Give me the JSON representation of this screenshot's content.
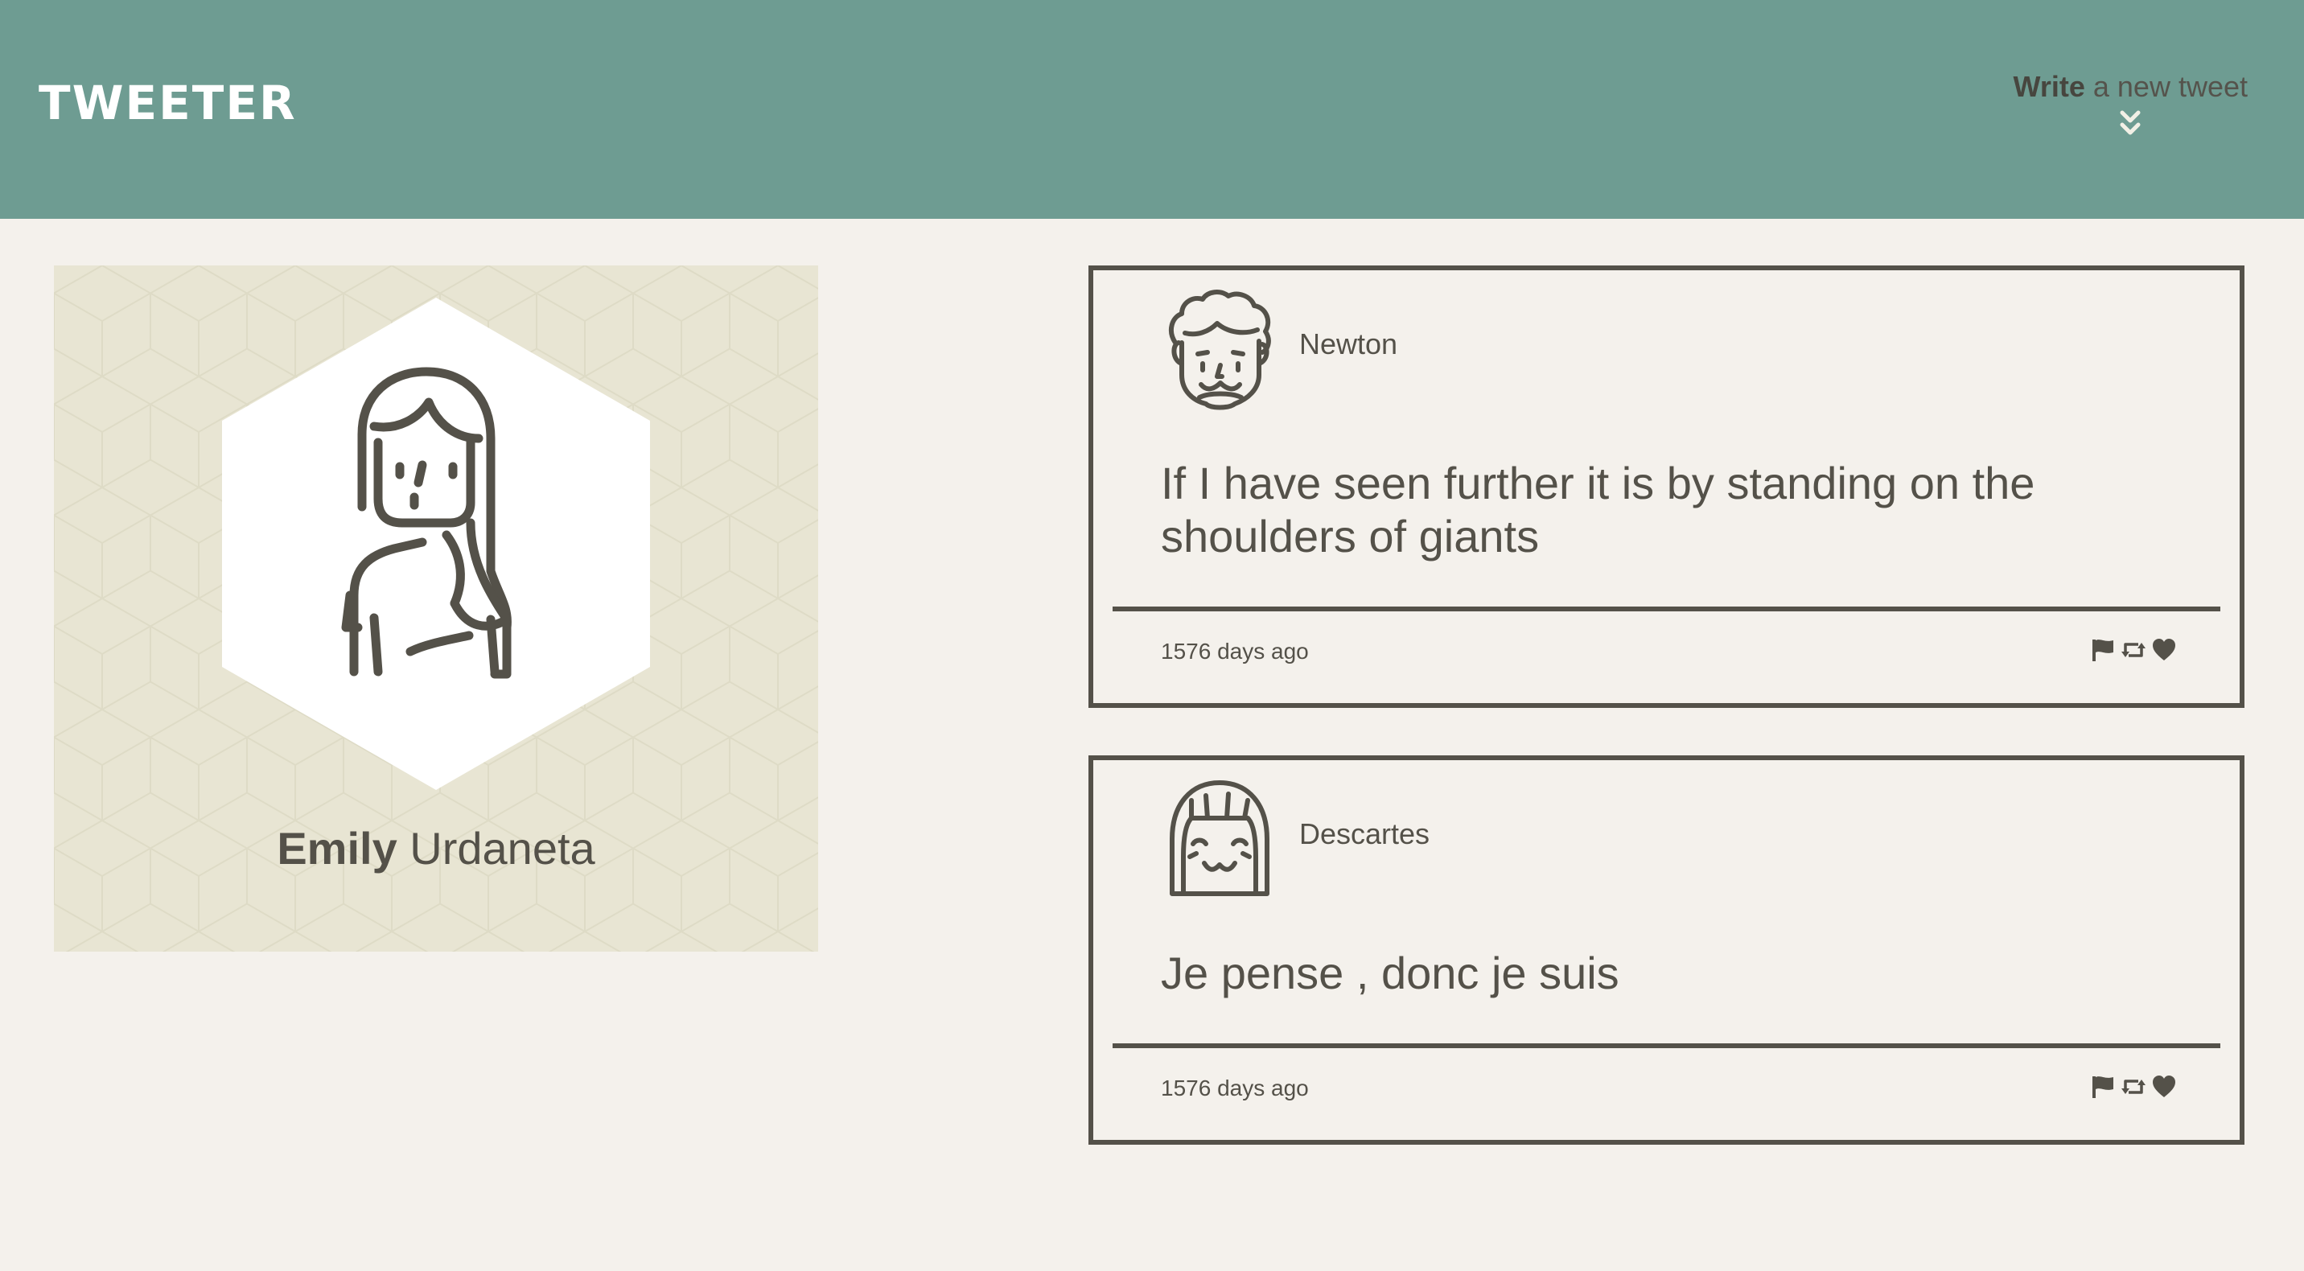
{
  "header": {
    "brand": "TWEETER",
    "compose_bold": "Write",
    "compose_rest": " a new tweet",
    "compose_icon": "double-chevron-down-icon"
  },
  "profile": {
    "first_name": "Emily",
    "last_name": " Urdaneta",
    "avatar_icon": "woman-avatar-icon"
  },
  "tweets": [
    {
      "author": "Newton",
      "avatar_icon": "curly-hair-man-avatar-icon",
      "text": "If I have seen further it is by standing on the shoulders of giants",
      "time": "1576 days ago",
      "actions": [
        "flag-icon",
        "retweet-icon",
        "heart-icon"
      ]
    },
    {
      "author": "Descartes",
      "avatar_icon": "bob-hair-avatar-icon",
      "text": "Je pense , donc je suis",
      "time": "1576 days ago",
      "actions": [
        "flag-icon",
        "retweet-icon",
        "heart-icon"
      ]
    }
  ],
  "colors": {
    "header_bg": "#6e9c92",
    "page_bg": "#f4f1ec",
    "profile_bg": "#e8e5d3",
    "ink": "#545149"
  }
}
